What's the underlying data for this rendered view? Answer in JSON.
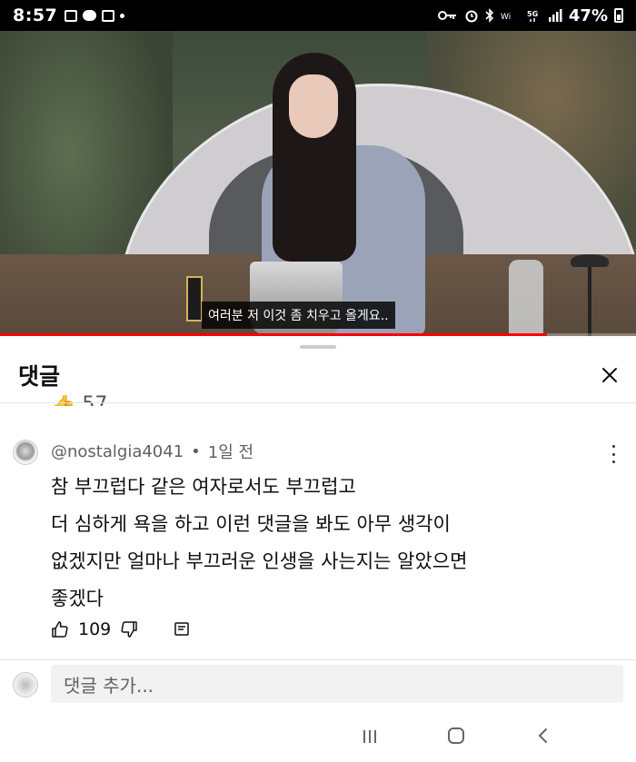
{
  "status_bar": {
    "time": "8:57",
    "battery": "47%"
  },
  "video": {
    "subtitle": "여러분 저 이것 좀 치우고 올게요..",
    "progress": 0.86
  },
  "comments_sheet": {
    "title": "댓글",
    "prev_likes_fragment": "57",
    "comment": {
      "author": "@nostalgia4041",
      "separator": "•",
      "time_ago": "1일 전",
      "text_lines": [
        "참 부끄럽다 같은 여자로서도 부끄럽고",
        "더 심하게 욕을 하고 이런 댓글을 봐도 아무 생각이",
        "없겠지만 얼마나 부끄러운 인생을 사는지는 알았으면",
        "좋겠다"
      ],
      "like_count": "109"
    },
    "input_placeholder": "댓글 추가..."
  },
  "icons": {
    "close": "close-icon",
    "like": "thumbs-up-icon",
    "dislike": "thumbs-down-icon",
    "reply": "reply-icon",
    "menu": "more-vert-icon"
  }
}
